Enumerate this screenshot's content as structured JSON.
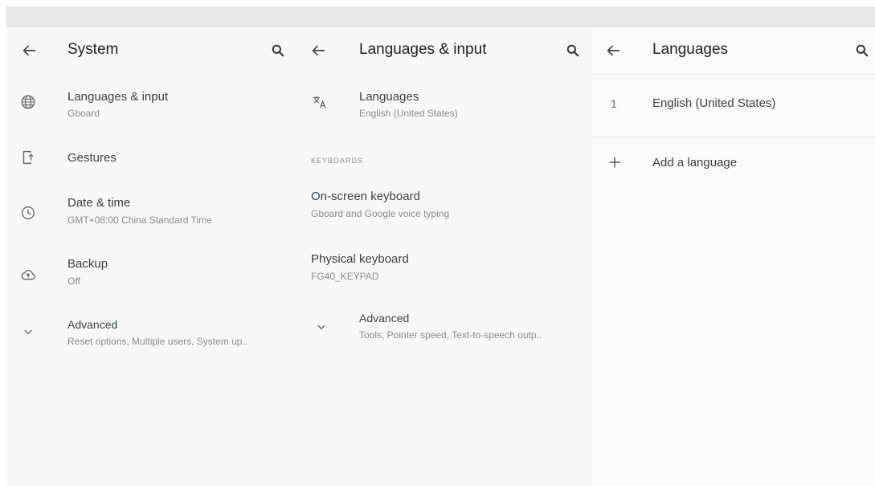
{
  "system": {
    "title": "System",
    "items": [
      {
        "label": "Languages & input",
        "sub": "Gboard",
        "icon": "globe-icon"
      },
      {
        "label": "Gestures",
        "sub": "",
        "icon": "gestures-icon"
      },
      {
        "label": "Date & time",
        "sub": "GMT+08:00 China Standard Time",
        "icon": "clock-icon"
      },
      {
        "label": "Backup",
        "sub": "Off",
        "icon": "cloud-backup-icon"
      },
      {
        "label": "Advanced",
        "sub": "Reset options, Multiple users, System up..",
        "icon": "chevron-down-icon"
      }
    ]
  },
  "languages_input": {
    "title": "Languages & input",
    "languages": {
      "label": "Languages",
      "sub": "English (United States)",
      "icon": "translate-icon"
    },
    "keyboards_header": "KEYBOARDS",
    "on_screen_keyboard": {
      "label": "On-screen keyboard",
      "sub": "Gboard and Google voice typing"
    },
    "physical_keyboard": {
      "label": "Physical keyboard",
      "sub": "FG40_KEYPAD"
    },
    "advanced": {
      "label": "Advanced",
      "sub": "Tools, Pointer speed, Text-to-speech outp..",
      "icon": "chevron-down-icon"
    }
  },
  "languages": {
    "title": "Languages",
    "list": [
      {
        "number": "1",
        "name": "English (United States)"
      }
    ],
    "add_language": "Add a language"
  }
}
